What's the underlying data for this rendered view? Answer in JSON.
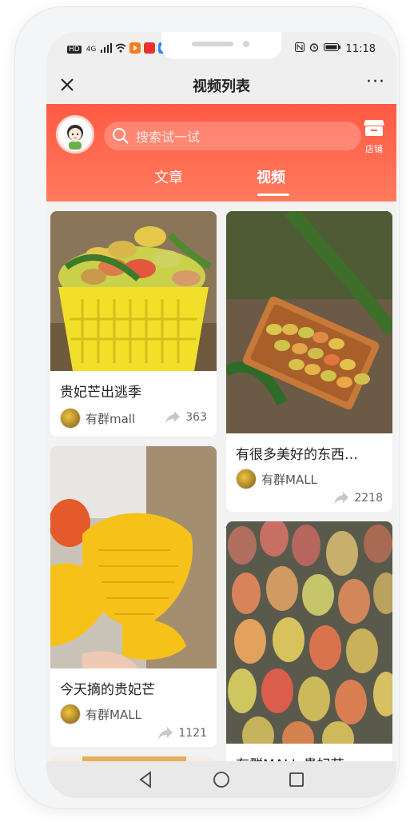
{
  "status_bar": {
    "left_badges": [
      "HD",
      "4G"
    ],
    "time": "11:18",
    "right_icons": [
      "nfc-icon",
      "alarm-icon",
      "battery-icon"
    ]
  },
  "titlebar": {
    "close_icon": "close-icon",
    "title": "视频列表",
    "more": "···"
  },
  "header": {
    "search_placeholder": "搜索试一试",
    "store_label": "店铺",
    "tabs": [
      {
        "label": "文章",
        "active": false
      },
      {
        "label": "视频",
        "active": true
      }
    ],
    "colors": {
      "accent": "#ff5a44"
    }
  },
  "feed": {
    "cards": [
      {
        "title": "贵妃芒出逃季",
        "author": "有群mall",
        "shares": "363"
      },
      {
        "title": "有很多美好的东西…",
        "author": "有群MALL",
        "shares": "2218"
      },
      {
        "title": "今天摘的贵妃芒",
        "author": "有群MALL",
        "shares": "1121"
      },
      {
        "title": "有群MALL 贵妃芒",
        "author": "",
        "shares": ""
      }
    ]
  },
  "navbar": {
    "buttons": [
      "back-icon",
      "home-icon",
      "recents-icon"
    ]
  }
}
